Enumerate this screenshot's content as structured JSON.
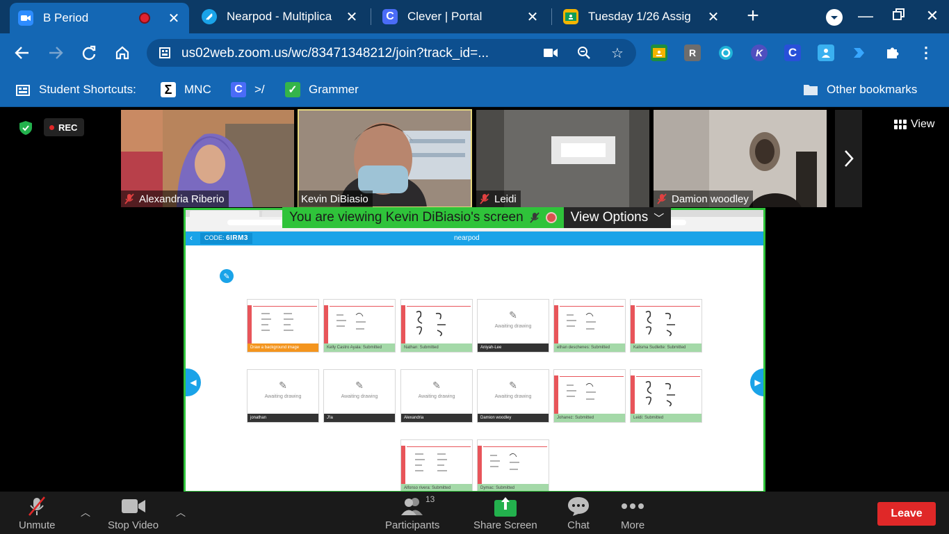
{
  "browser": {
    "tabs": [
      {
        "title": "B Period",
        "recording": true
      },
      {
        "title": "Nearpod - Multiplica"
      },
      {
        "title": "Clever | Portal"
      },
      {
        "title": "Tuesday 1/26 Assig"
      }
    ],
    "url": "us02web.zoom.us/wc/83471348212/join?track_id=...",
    "bookmarks_label": "Student Shortcuts:",
    "bookmarks": [
      "MNC",
      ">/",
      "Grammer"
    ],
    "other_bookmarks": "Other bookmarks"
  },
  "zoom": {
    "rec_label": "REC",
    "view_label": "View",
    "participants": [
      {
        "name": "Alexandria Riberio",
        "muted": true,
        "color": "#8a7a9e"
      },
      {
        "name": "Kevin DiBiasio",
        "muted": false,
        "speaking": true,
        "color": "#a6968a"
      },
      {
        "name": "Leidi",
        "muted": true,
        "color": "#5a5a58"
      },
      {
        "name": "Damion woodley",
        "muted": true,
        "color": "#b9b3ad"
      }
    ],
    "banner_text": "You are viewing Kevin DiBiasio's screen",
    "view_options": "View Options"
  },
  "nearpod": {
    "code_label": "CODE:",
    "code": "6IRM3",
    "logo": "nearpod",
    "cards": [
      {
        "label": "Draw a background image",
        "status": "orange",
        "type": "sheet"
      },
      {
        "label": "Kelly Castro Ayala: Submitted",
        "status": "sub",
        "type": "sheet"
      },
      {
        "label": "Nathan: Submitted",
        "status": "sub",
        "type": "sheet"
      },
      {
        "label": "Aniyah-Lee",
        "status": "dark",
        "type": "await"
      },
      {
        "label": "ethan deschenes: Submitted",
        "status": "sub",
        "type": "sheet"
      },
      {
        "label": "Kalisma Sudlette: Submitted",
        "status": "sub",
        "type": "sheet"
      },
      {
        "label": "jonathan",
        "status": "dark",
        "type": "await"
      },
      {
        "label": "J'la",
        "status": "dark",
        "type": "await"
      },
      {
        "label": "Alexandria",
        "status": "dark",
        "type": "await"
      },
      {
        "label": "Damion woodley",
        "status": "dark",
        "type": "await"
      },
      {
        "label": "Johanez: Submitted",
        "status": "sub",
        "type": "sheet"
      },
      {
        "label": "Leidi: Submitted",
        "status": "sub",
        "type": "sheet"
      },
      {
        "label": "Alfonso rivera: Submitted",
        "status": "sub",
        "type": "sheet"
      },
      {
        "label": "Dymac: Submitted",
        "status": "sub",
        "type": "sheet"
      }
    ],
    "awaiting_text": "Awaiting drawing"
  },
  "toolbar": {
    "unmute": "Unmute",
    "stop_video": "Stop Video",
    "participants": "Participants",
    "participant_count": "13",
    "share_screen": "Share Screen",
    "chat": "Chat",
    "more": "More",
    "leave": "Leave"
  }
}
